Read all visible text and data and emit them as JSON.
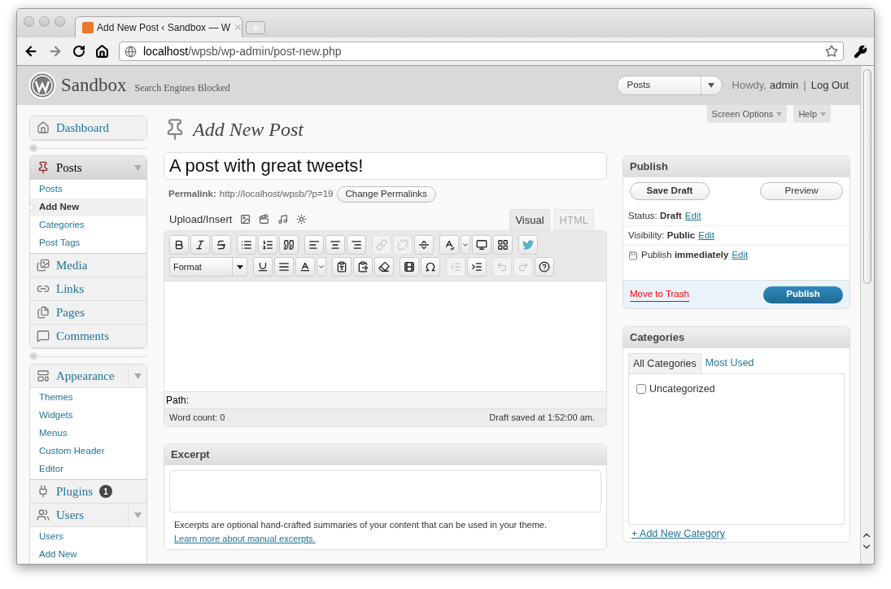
{
  "browser": {
    "tab_title": "Add New Post ‹ Sandbox — W",
    "url_host": "localhost",
    "url_path": "/wpsb/wp-admin/post-new.php",
    "forward_disabled": true
  },
  "header": {
    "site_name": "Sandbox",
    "site_note": "Search Engines Blocked",
    "favorites": "Posts",
    "greeting": "Howdy,",
    "user": "admin",
    "separator": "|",
    "logout": "Log Out"
  },
  "screen_meta": [
    "Screen Options",
    "Help"
  ],
  "menu_groups": [
    [
      {
        "label": "Dashboard",
        "current": false,
        "toggle": false
      }
    ],
    [
      {
        "label": "Posts",
        "current": true,
        "toggle": true,
        "submenu": [
          {
            "label": "Posts",
            "selected": false
          },
          {
            "label": "Add New",
            "selected": true
          },
          {
            "label": "Categories",
            "selected": false
          },
          {
            "label": "Post Tags",
            "selected": false
          }
        ]
      },
      {
        "label": "Media",
        "current": false,
        "toggle": false
      },
      {
        "label": "Links",
        "current": false,
        "toggle": false
      },
      {
        "label": "Pages",
        "current": false,
        "toggle": false
      },
      {
        "label": "Comments",
        "current": false,
        "toggle": false
      }
    ],
    [
      {
        "label": "Appearance",
        "current": false,
        "toggle": true,
        "submenu": [
          {
            "label": "Themes",
            "selected": false
          },
          {
            "label": "Widgets",
            "selected": false
          },
          {
            "label": "Menus",
            "selected": false
          },
          {
            "label": "Custom Header",
            "selected": false
          },
          {
            "label": "Editor",
            "selected": false
          }
        ]
      },
      {
        "label": "Plugins",
        "current": false,
        "toggle": false,
        "badge": "1"
      },
      {
        "label": "Users",
        "current": false,
        "toggle": true,
        "submenu": [
          {
            "label": "Users",
            "selected": false
          },
          {
            "label": "Add New",
            "selected": false
          }
        ]
      }
    ]
  ],
  "page_title": "Add New Post",
  "post_title": "A post with great tweets!",
  "permalink": {
    "label": "Permalink:",
    "url": "http://localhost/wpsb/?p=19",
    "button": "Change Permalinks"
  },
  "upload": {
    "label": "Upload/Insert"
  },
  "editor_tabs": [
    {
      "label": "Visual",
      "selected": true
    },
    {
      "label": "HTML",
      "selected": false
    }
  ],
  "format_select": "Format",
  "toolbar_rows": [
    [
      [
        {
          "kind": "bold",
          "disabled": false
        },
        {
          "kind": "italic",
          "disabled": false
        },
        {
          "kind": "strikethrough",
          "disabled": false
        }
      ],
      [
        {
          "kind": "bullet-list",
          "disabled": false
        },
        {
          "kind": "numbered-list",
          "disabled": false
        },
        {
          "kind": "blockquote",
          "disabled": false
        }
      ],
      [
        {
          "kind": "align-left",
          "disabled": false
        },
        {
          "kind": "align-center",
          "disabled": false
        },
        {
          "kind": "align-right",
          "disabled": false
        }
      ],
      [
        {
          "kind": "link",
          "disabled": true
        },
        {
          "kind": "unlink",
          "disabled": true
        },
        {
          "kind": "more",
          "disabled": false
        }
      ],
      [
        {
          "kind": "spellcheck",
          "disabled": false
        },
        {
          "kind": "dropdown",
          "disabled": false
        },
        {
          "kind": "fullscreen",
          "disabled": false
        },
        {
          "kind": "kitchen-sink",
          "disabled": false
        }
      ],
      [
        {
          "kind": "bird",
          "disabled": false
        }
      ]
    ],
    [
      [
        {
          "kind": "format"
        }
      ],
      [
        {
          "kind": "underline",
          "disabled": false
        },
        {
          "kind": "justify",
          "disabled": false
        },
        {
          "kind": "text-color",
          "disabled": false
        },
        {
          "kind": "dropdown",
          "disabled": false
        }
      ],
      [
        {
          "kind": "paste-text",
          "disabled": false
        },
        {
          "kind": "paste-document",
          "disabled": false
        },
        {
          "kind": "eraser",
          "disabled": false
        }
      ],
      [
        {
          "kind": "film",
          "disabled": false
        },
        {
          "kind": "omega",
          "disabled": false
        }
      ],
      [
        {
          "kind": "outdent",
          "disabled": true
        },
        {
          "kind": "indent",
          "disabled": false
        }
      ],
      [
        {
          "kind": "undo",
          "disabled": true
        },
        {
          "kind": "redo",
          "disabled": true
        },
        {
          "kind": "help",
          "disabled": false
        }
      ]
    ]
  ],
  "path_label": "Path:",
  "word_count": "Word count: 0",
  "draft_saved": "Draft saved at 1:52:00 am.",
  "excerpt": {
    "title": "Excerpt",
    "help": "Excerpts are optional hand-crafted summaries of your content that can be used in your theme.",
    "link": "Learn more about manual excerpts."
  },
  "publish": {
    "title": "Publish",
    "save_draft": "Save Draft",
    "preview": "Preview",
    "rows": [
      {
        "text": "Status: **Draft**",
        "edit": "Edit"
      },
      {
        "text": "Visibility: **Public**",
        "edit": "Edit"
      },
      {
        "text": "Publish **immediately**",
        "edit": "Edit"
      }
    ],
    "trash": "Move to Trash",
    "publish_button": "Publish"
  },
  "categories": {
    "title": "Categories",
    "tabs": [
      {
        "label": "All Categories",
        "selected": true
      },
      {
        "label": "Most Used",
        "selected": false
      }
    ],
    "items": [
      {
        "label": "Uncategorized",
        "checked": false
      }
    ],
    "add_link": "+ Add New Category"
  }
}
